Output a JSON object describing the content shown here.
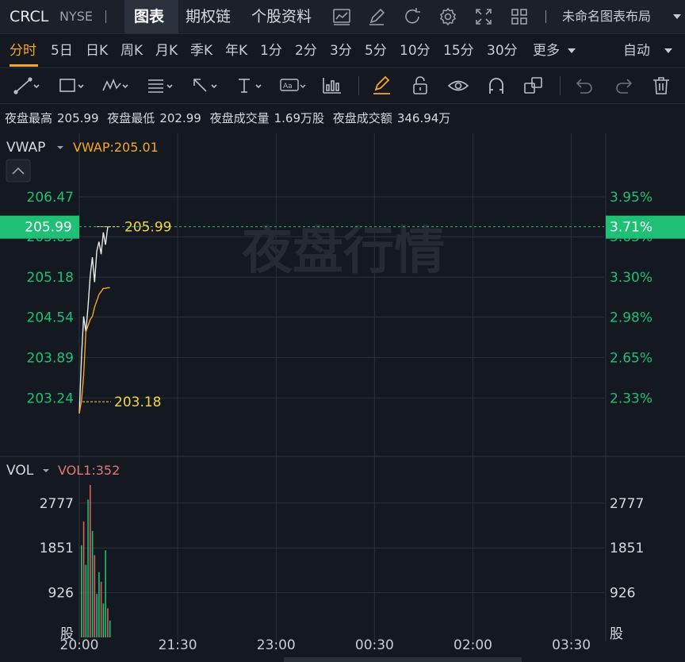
{
  "header": {
    "ticker": "CRCL",
    "exchange": "NYSE",
    "tabs": [
      "图表",
      "期权链",
      "个股资料"
    ],
    "layout_name": "未命名图表布局",
    "icons": [
      "line-chart-icon",
      "edit-icon",
      "refresh-icon",
      "gear-icon",
      "fullscreen-icon",
      "grid-layout-icon"
    ]
  },
  "periods": {
    "items": [
      "分时",
      "5日",
      "日K",
      "周K",
      "月K",
      "季K",
      "年K",
      "1分",
      "2分",
      "3分",
      "5分",
      "10分",
      "15分",
      "30分",
      "更多"
    ],
    "active": "分时",
    "mode": "自动"
  },
  "tools": [
    "trend-line-icon",
    "rectangle-icon",
    "pattern-icon",
    "fibonacci-icon",
    "arrow-icon",
    "text-icon",
    "annotation-icon",
    "indicator-icon",
    "highlighter-icon",
    "lock-icon",
    "eye-icon",
    "magnet-icon",
    "layers-icon",
    "undo-icon",
    "redo-icon",
    "trash-icon"
  ],
  "info": {
    "high_label": "夜盘最高",
    "high": "205.99",
    "low_label": "夜盘最低",
    "low": "202.99",
    "vol_label": "夜盘成交量",
    "vol": "1.69万股",
    "amt_label": "夜盘成交额",
    "amt": "346.94万"
  },
  "main_panel": {
    "indicator": "VWAP",
    "indicator_value": "VWAP:205.01",
    "watermark": "夜盘行情",
    "current_price": "205.99",
    "current_pct": "3.71%",
    "high_marker": "205.99",
    "low_marker": "203.18"
  },
  "vol_panel": {
    "indicator": "VOL",
    "indicator_value": "VOL1:352",
    "unit": "股"
  },
  "colors": {
    "up": "#1fbf75",
    "down": "#e35c5c",
    "vwap": "#f5a623",
    "price_line": "#e8e8e8",
    "marker": "#f2d544",
    "active": "#f5a623"
  },
  "chart_data": {
    "type": "line",
    "x_ticks": [
      "20:00",
      "21:30",
      "23:00",
      "00:30",
      "02:00",
      "03:30"
    ],
    "x_range": [
      "20:00",
      "04:00"
    ],
    "y_ticks_price": [
      206.47,
      205.83,
      205.18,
      204.54,
      203.89,
      203.24
    ],
    "y_ticks_pct": [
      "3.95%",
      "3.63%",
      "3.30%",
      "2.98%",
      "2.65%",
      "2.33%"
    ],
    "ylim": [
      202.99,
      206.47
    ],
    "series": [
      {
        "name": "price",
        "x": [
          "20:00",
          "20:02",
          "20:04",
          "20:06",
          "20:08",
          "20:10",
          "20:12",
          "20:14",
          "20:16",
          "20:18",
          "20:20",
          "20:22",
          "20:24",
          "20:26",
          "20:28"
        ],
        "values": [
          202.99,
          203.9,
          204.55,
          204.3,
          204.7,
          205.2,
          205.5,
          205.1,
          205.6,
          205.75,
          205.55,
          205.9,
          205.7,
          205.99,
          205.99
        ]
      },
      {
        "name": "VWAP",
        "x": [
          "20:00",
          "20:02",
          "20:04",
          "20:06",
          "20:08",
          "20:10",
          "20:12",
          "20:14",
          "20:16",
          "20:18",
          "20:20",
          "20:22",
          "20:24",
          "20:26",
          "20:28"
        ],
        "values": [
          202.99,
          203.2,
          203.6,
          204.3,
          204.4,
          204.5,
          204.55,
          204.7,
          204.8,
          204.9,
          204.95,
          205.0,
          205.0,
          205.01,
          205.01
        ]
      }
    ],
    "volume": {
      "y_ticks": [
        2777,
        1851,
        926
      ],
      "ylim": [
        0,
        3200
      ],
      "x": [
        "20:00",
        "20:02",
        "20:04",
        "20:06",
        "20:08",
        "20:10",
        "20:12",
        "20:14",
        "20:16",
        "20:18",
        "20:20",
        "20:22",
        "20:24",
        "20:26"
      ],
      "values": [
        1900,
        2400,
        1500,
        2850,
        3150,
        2200,
        1700,
        900,
        1350,
        1150,
        700,
        1800,
        600,
        350
      ],
      "up": [
        true,
        false,
        true,
        true,
        false,
        true,
        false,
        true,
        true,
        false,
        true,
        true,
        false,
        true
      ]
    }
  }
}
